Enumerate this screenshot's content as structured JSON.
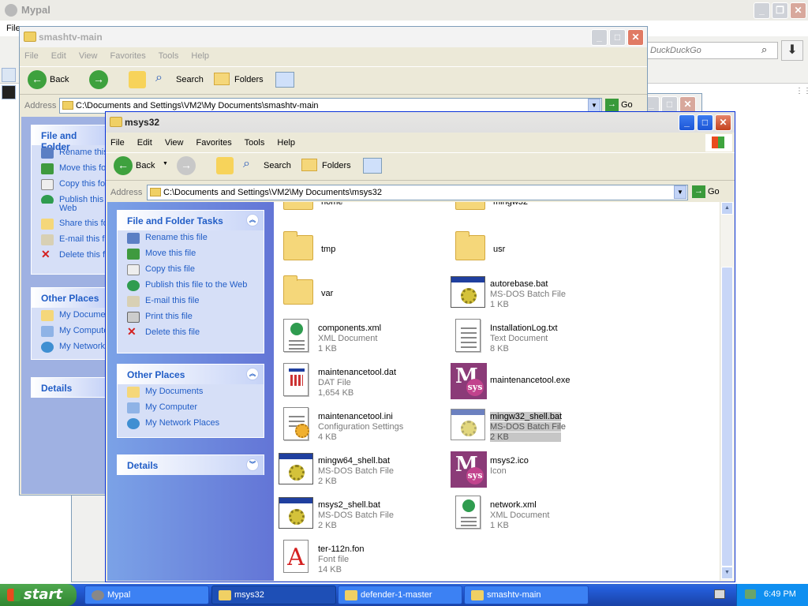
{
  "mypal": {
    "title": "Mypal",
    "menu_first": "File",
    "search_placeholder": "DuckDuckGo"
  },
  "smashtv": {
    "title": "smashtv-main",
    "menu": [
      "File",
      "Edit",
      "View",
      "Favorites",
      "Tools",
      "Help"
    ],
    "toolbar": {
      "back": "Back",
      "search": "Search",
      "folders": "Folders"
    },
    "address_label": "Address",
    "address": "C:\\Documents and Settings\\VM2\\My Documents\\smashtv-main",
    "go": "Go",
    "tasks_title": "File and Folder",
    "tasks": [
      "Rename this",
      "Move this fo",
      "Copy this fo",
      "Publish this",
      "Web",
      "Share this fo",
      "E-mail this f",
      "Delete this f"
    ],
    "places_title": "Other Places",
    "places": [
      "My Documer",
      "My Compute",
      "My Network"
    ],
    "details_title": "Details"
  },
  "msys": {
    "title": "msys32",
    "menu": [
      "File",
      "Edit",
      "View",
      "Favorites",
      "Tools",
      "Help"
    ],
    "toolbar": {
      "back": "Back",
      "search": "Search",
      "folders": "Folders"
    },
    "address_label": "Address",
    "address": "C:\\Documents and Settings\\VM2\\My Documents\\msys32",
    "go": "Go",
    "tasks_title": "File and Folder Tasks",
    "tasks": [
      "Rename this file",
      "Move this file",
      "Copy this file",
      "Publish this file to the Web",
      "E-mail this file",
      "Print this file",
      "Delete this file"
    ],
    "places_title": "Other Places",
    "places": [
      "My Documents",
      "My Computer",
      "My Network Places"
    ],
    "details_title": "Details",
    "files": [
      {
        "name": "home",
        "type": "",
        "size": "",
        "icon": "folder-icon"
      },
      {
        "name": "mingw32",
        "type": "",
        "size": "",
        "icon": "folder-icon"
      },
      {
        "name": "tmp",
        "type": "",
        "size": "",
        "icon": "folder-icon"
      },
      {
        "name": "usr",
        "type": "",
        "size": "",
        "icon": "folder-icon"
      },
      {
        "name": "var",
        "type": "",
        "size": "",
        "icon": "folder-icon"
      },
      {
        "name": "autorebase.bat",
        "type": "MS-DOS Batch File",
        "size": "1 KB",
        "icon": "batch-file-icon"
      },
      {
        "name": "components.xml",
        "type": "XML Document",
        "size": "1 KB",
        "icon": "xml-document-icon"
      },
      {
        "name": "InstallationLog.txt",
        "type": "Text Document",
        "size": "8 KB",
        "icon": "text-document-icon"
      },
      {
        "name": "maintenancetool.dat",
        "type": "DAT File",
        "size": "1,654 KB",
        "icon": "dat-file-icon"
      },
      {
        "name": "maintenancetool.exe",
        "type": "",
        "size": "",
        "icon": "msys2-app-icon"
      },
      {
        "name": "maintenancetool.ini",
        "type": "Configuration Settings",
        "size": "4 KB",
        "icon": "config-file-icon"
      },
      {
        "name": "mingw32_shell.bat",
        "type": "MS-DOS Batch File",
        "size": "2 KB",
        "icon": "batch-file-icon"
      },
      {
        "name": "mingw64_shell.bat",
        "type": "MS-DOS Batch File",
        "size": "2 KB",
        "icon": "batch-file-icon"
      },
      {
        "name": "msys2.ico",
        "type": "Icon",
        "size": "",
        "icon": "msys2-app-icon"
      },
      {
        "name": "msys2_shell.bat",
        "type": "MS-DOS Batch File",
        "size": "2 KB",
        "icon": "batch-file-icon"
      },
      {
        "name": "network.xml",
        "type": "XML Document",
        "size": "1 KB",
        "icon": "xml-document-icon"
      },
      {
        "name": "ter-112n.fon",
        "type": "Font file",
        "size": "14 KB",
        "icon": "font-file-icon"
      }
    ]
  },
  "taskbar": {
    "start": "start",
    "tasks": [
      "Mypal",
      "msys32",
      "defender-1-master",
      "smashtv-main"
    ],
    "clock": "6:49 PM"
  }
}
